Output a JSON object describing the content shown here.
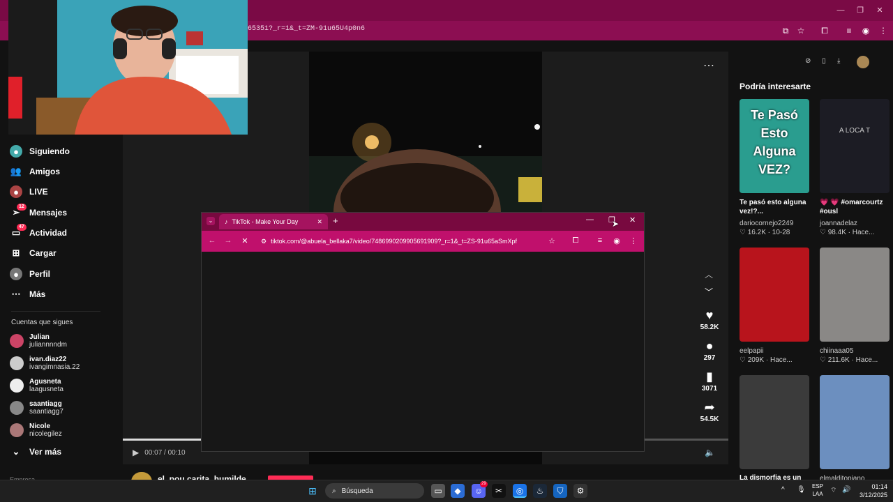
{
  "back_browser": {
    "url": "6535​1?_r=1&_t=ZM-91u65U4p0n6",
    "toolbar_icons": [
      "screencast-icon",
      "star-icon",
      "extensions-icon",
      "media-icon",
      "profile-icon",
      "menu-icon"
    ]
  },
  "sidebar": {
    "items": [
      {
        "label": "Siguiendo",
        "icon": "following-icon"
      },
      {
        "label": "Amigos",
        "icon": "friends-icon"
      },
      {
        "label": "LIVE",
        "icon": "live-icon"
      },
      {
        "label": "Mensajes",
        "icon": "messages-icon",
        "badge": "12"
      },
      {
        "label": "Actividad",
        "icon": "activity-icon",
        "badge": "47"
      },
      {
        "label": "Cargar",
        "icon": "upload-icon"
      },
      {
        "label": "Perfil",
        "icon": "profile-icon"
      },
      {
        "label": "Más",
        "icon": "more-icon"
      }
    ],
    "following_title": "Cuentas que sigues",
    "accounts": [
      {
        "name": "Julian",
        "handle": "juliannnndm"
      },
      {
        "name": "ivan.diaz22",
        "handle": "ivangimnasia.22"
      },
      {
        "name": "Agusneta",
        "handle": "laagusneta"
      },
      {
        "name": "saantiagg",
        "handle": "saantiagg7"
      },
      {
        "name": "Nicole",
        "handle": "nicolegilez"
      }
    ],
    "see_more": "Ver más",
    "footer_cut": "Empresa"
  },
  "video": {
    "time": "00:07 / 00:10",
    "progress": 0.7,
    "author": "el_pou carita_humilde"
  },
  "actions": [
    {
      "icon": "heart-icon",
      "glyph": "♥",
      "count": "58.2K"
    },
    {
      "icon": "comment-icon",
      "glyph": "💬",
      "count": "297"
    },
    {
      "icon": "bookmark-icon",
      "glyph": "🔖",
      "count": "3071"
    },
    {
      "icon": "share-icon",
      "glyph": "➦",
      "count": "54.5K"
    }
  ],
  "recommendations": {
    "title": "Podría interesarte",
    "items": [
      {
        "caption": "Te pasó esto alguna vez!?...",
        "user": "dariocornejo2249",
        "stats": "♡ 16.2K · 10-28",
        "thumb_text": "Te Pasó Esto Alguna VEZ?",
        "color": "#2a9d8f"
      },
      {
        "caption": "💗 💗 #omarcourtz #ousl",
        "user": "joannadelaz",
        "stats": "♡ 98.4K · Hace...",
        "thumb_text": "A LOCA T",
        "color": "#1c1c24"
      },
      {
        "caption": "",
        "user": "eelpapii",
        "stats": "♡ 209K · Hace...",
        "thumb_text": "",
        "color": "#b8141c"
      },
      {
        "caption": "",
        "user": "chiinaaa05",
        "stats": "♡ 211.6K · Hace...",
        "thumb_text": "",
        "color": "#8a8886"
      },
      {
        "caption": "La dismorfia es un",
        "user": "",
        "stats": "",
        "thumb_text": "",
        "color": "#3b3b3b"
      },
      {
        "caption": "",
        "user": "elmalditopiano",
        "stats": "",
        "thumb_text": "",
        "color": "#6c8fbf"
      }
    ]
  },
  "popup": {
    "tab_title": "TikTok - Make Your Day",
    "url": "tiktok.com/@abuela_bellaka7/video/7486990209905691909?_r=1&_t=ZS-91u65aSmXpf"
  },
  "taskbar": {
    "search": "Búsqueda",
    "lang_top": "ESP",
    "lang_bottom": "LAA",
    "time": "01:14",
    "date": "3/12/2025",
    "discord_badge": "29"
  },
  "colors": {
    "chrome_dark": "#7a0a45",
    "chrome_light": "#c0106c",
    "tiktok_red": "#fe2c55"
  }
}
